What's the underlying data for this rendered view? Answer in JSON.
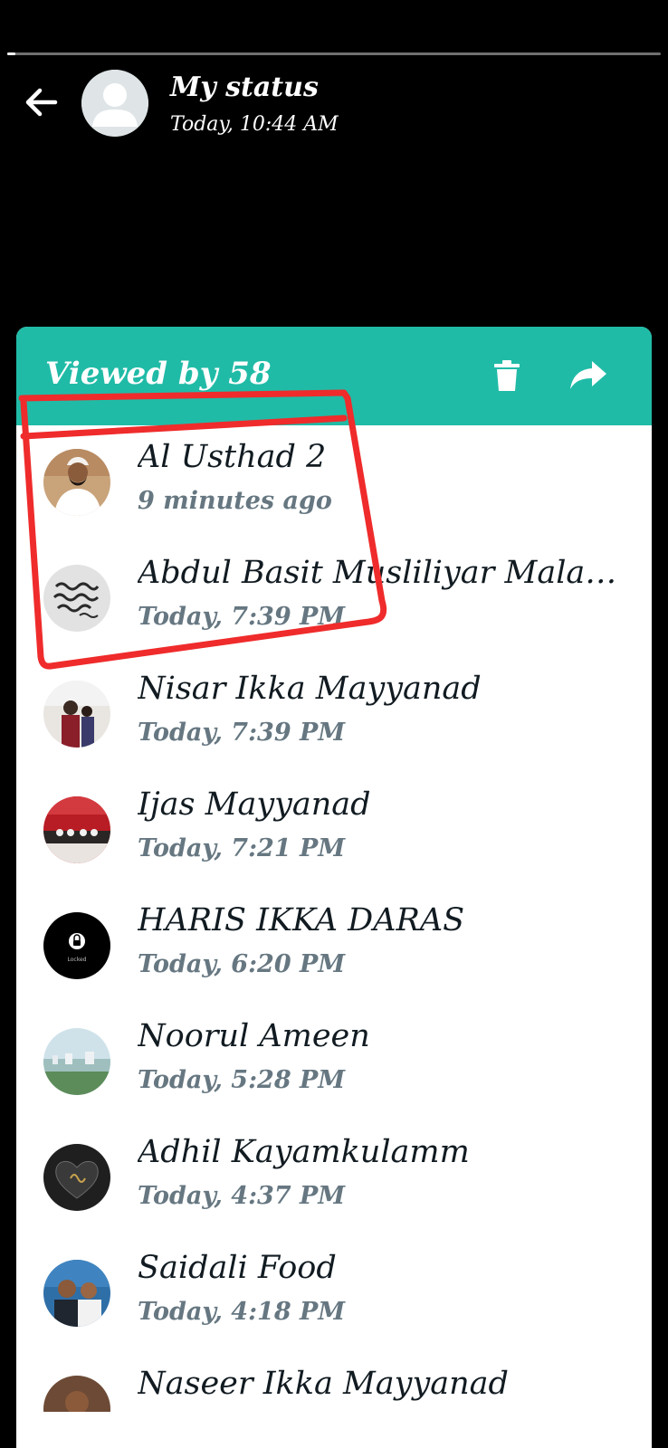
{
  "status": {
    "title": "My status",
    "timestamp": "Today, 10:44 AM",
    "progress": 0.012
  },
  "sheet": {
    "viewed_by": "Viewed by 58",
    "delete_icon": "trash-icon",
    "forward_icon": "forward-icon",
    "accent_color": "#20bba7"
  },
  "viewers": [
    {
      "name": "Al Usthad 2",
      "time": "9 minutes ago"
    },
    {
      "name": "Abdul Basit Musliliyar Malapp...",
      "time": "Today, 7:39 PM"
    },
    {
      "name": "Nisar Ikka Mayyanad",
      "time": "Today, 7:39 PM"
    },
    {
      "name": "Ijas Mayyanad",
      "time": "Today, 7:21 PM"
    },
    {
      "name": "HARIS IKKA DARAS",
      "time": "Today, 6:20 PM"
    },
    {
      "name": "Noorul Ameen",
      "time": "Today, 5:28 PM"
    },
    {
      "name": "Adhil Kayamkulamm",
      "time": "Today, 4:37 PM"
    },
    {
      "name": "Saidali Food",
      "time": "Today, 4:18 PM"
    },
    {
      "name": "Naseer Ikka Mayyanad",
      "time": ""
    }
  ],
  "locked_avatar_label": "Locked",
  "annotation_color": "#ef2b2b"
}
